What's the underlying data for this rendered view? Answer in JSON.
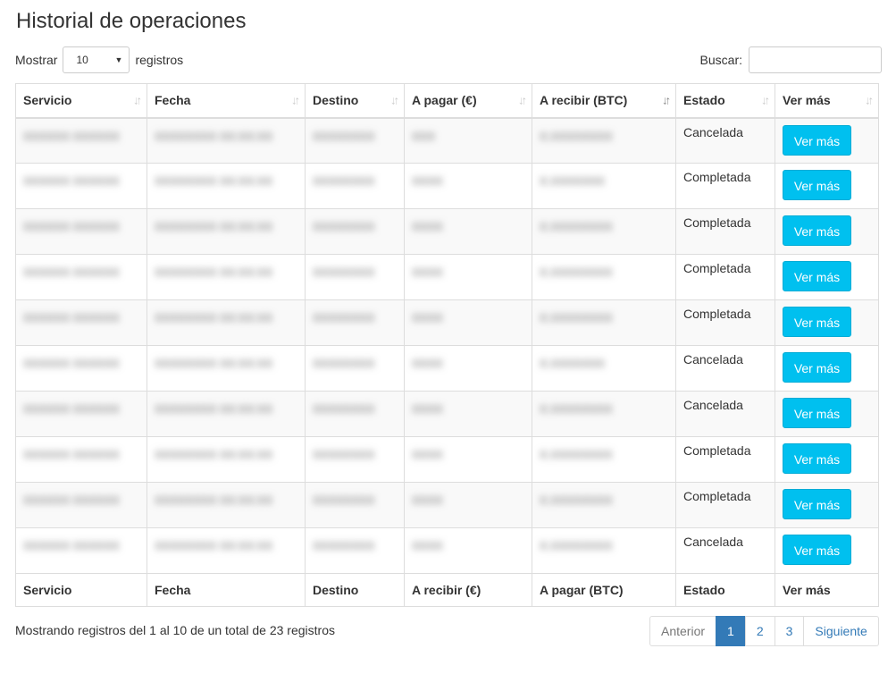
{
  "title": "Historial de operaciones",
  "length_menu": {
    "prefix": "Mostrar",
    "value": "10",
    "suffix": "registros"
  },
  "search": {
    "label": "Buscar:",
    "value": ""
  },
  "columns": [
    "Servicio",
    "Fecha",
    "Destino",
    "A pagar (€)",
    "A recibir (BTC)",
    "Estado",
    "Ver más"
  ],
  "sorted_column": "A recibir (BTC)",
  "footer_columns": [
    "Servicio",
    "Fecha",
    "Destino",
    "A recibir (€)",
    "A pagar (BTC)",
    "Estado",
    "Ver más"
  ],
  "rows": [
    {
      "servicio": "XXXXXX XXXXXX",
      "fecha": "XXXXXXXX XX:XX:XX",
      "destino": "XXXXXXXX",
      "pagar": "XXX",
      "recibir": "X.XXXXXXXX",
      "estado": "Cancelada",
      "action": "Ver más"
    },
    {
      "servicio": "XXXXXX XXXXXX",
      "fecha": "XXXXXXXX XX:XX:XX",
      "destino": "XXXXXXXX",
      "pagar": "XXXX",
      "recibir": "X.XXXXXXX",
      "estado": "Completada",
      "action": "Ver más"
    },
    {
      "servicio": "XXXXXX XXXXXX",
      "fecha": "XXXXXXXX XX:XX:XX",
      "destino": "XXXXXXXX",
      "pagar": "XXXX",
      "recibir": "X.XXXXXXXX",
      "estado": "Completada",
      "action": "Ver más"
    },
    {
      "servicio": "XXXXXX XXXXXX",
      "fecha": "XXXXXXXX XX:XX:XX",
      "destino": "XXXXXXXX",
      "pagar": "XXXX",
      "recibir": "X.XXXXXXXX",
      "estado": "Completada",
      "action": "Ver más"
    },
    {
      "servicio": "XXXXXX XXXXXX",
      "fecha": "XXXXXXXX XX:XX:XX",
      "destino": "XXXXXXXX",
      "pagar": "XXXX",
      "recibir": "X.XXXXXXXX",
      "estado": "Completada",
      "action": "Ver más"
    },
    {
      "servicio": "XXXXXX XXXXXX",
      "fecha": "XXXXXXXX XX:XX:XX",
      "destino": "XXXXXXXX",
      "pagar": "XXXX",
      "recibir": "X.XXXXXXX",
      "estado": "Cancelada",
      "action": "Ver más"
    },
    {
      "servicio": "XXXXXX XXXXXX",
      "fecha": "XXXXXXXX XX:XX:XX",
      "destino": "XXXXXXXX",
      "pagar": "XXXX",
      "recibir": "X.XXXXXXXX",
      "estado": "Cancelada",
      "action": "Ver más"
    },
    {
      "servicio": "XXXXXX XXXXXX",
      "fecha": "XXXXXXXX XX:XX:XX",
      "destino": "XXXXXXXX",
      "pagar": "XXXX",
      "recibir": "X.XXXXXXXX",
      "estado": "Completada",
      "action": "Ver más"
    },
    {
      "servicio": "XXXXXX XXXXXX",
      "fecha": "XXXXXXXX XX:XX:XX",
      "destino": "XXXXXXXX",
      "pagar": "XXXX",
      "recibir": "X.XXXXXXXX",
      "estado": "Completada",
      "action": "Ver más"
    },
    {
      "servicio": "XXXXXX XXXXXX",
      "fecha": "XXXXXXXX XX:XX:XX",
      "destino": "XXXXXXXX",
      "pagar": "XXXX",
      "recibir": "X.XXXXXXXX",
      "estado": "Cancelada",
      "action": "Ver más"
    }
  ],
  "info": "Mostrando registros del 1 al 10 de un total de 23 registros",
  "pagination": {
    "prev": "Anterior",
    "pages": [
      "1",
      "2",
      "3"
    ],
    "current": "1",
    "next": "Siguiente"
  },
  "colors": {
    "button": "#00c0ef",
    "active_page": "#337ab7",
    "link": "#337ab7"
  },
  "icons": {
    "sort": "sort-icon",
    "sort_active": "sort-desc-icon",
    "dropdown": "caret-down-icon"
  }
}
